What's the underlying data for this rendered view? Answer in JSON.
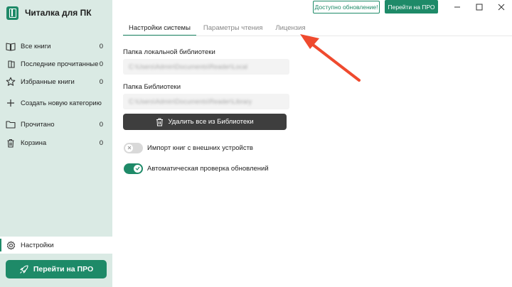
{
  "brand": {
    "title": "Читалка для ПК"
  },
  "sidebar": {
    "items": [
      {
        "label": "Все книги",
        "count": "0",
        "icon": "book-icon"
      },
      {
        "label": "Последние прочитанные",
        "count": "0",
        "icon": "recent-icon"
      },
      {
        "label": "Избранные книги",
        "count": "0",
        "icon": "star-icon"
      },
      {
        "label": "Создать новую категорию",
        "count": "",
        "icon": "plus-icon"
      },
      {
        "label": "Прочитано",
        "count": "0",
        "icon": "folder-icon"
      },
      {
        "label": "Корзина",
        "count": "0",
        "icon": "trash-icon"
      }
    ],
    "settings_label": "Настройки",
    "pro_button": "Перейти на ПРО"
  },
  "topbar": {
    "update_label": "Доступно обновление!",
    "pro_label": "Перейти на ПРО"
  },
  "tabs": [
    {
      "label": "Настройки системы",
      "active": true
    },
    {
      "label": "Параметры чтения",
      "active": false
    },
    {
      "label": "Лицензия",
      "active": false
    }
  ],
  "settings": {
    "local_library_label": "Папка локальной библиотеки",
    "local_library_value": "C:\\Users\\Admin\\Documents\\Reader\\Local",
    "library_label": "Папка Библиотеки",
    "library_value": "C:\\Users\\Admin\\Documents\\Reader\\Library",
    "delete_all_label": "Удалить все из Библиотеки",
    "import_label": "Импорт книг с внешних устройств",
    "import_enabled": false,
    "auto_update_label": "Автоматическая проверка обновлений",
    "auto_update_enabled": true
  },
  "colors": {
    "accent": "#1e8a68",
    "sidebar_bg": "#daeae4",
    "annotation_arrow": "#ef4a2e"
  }
}
